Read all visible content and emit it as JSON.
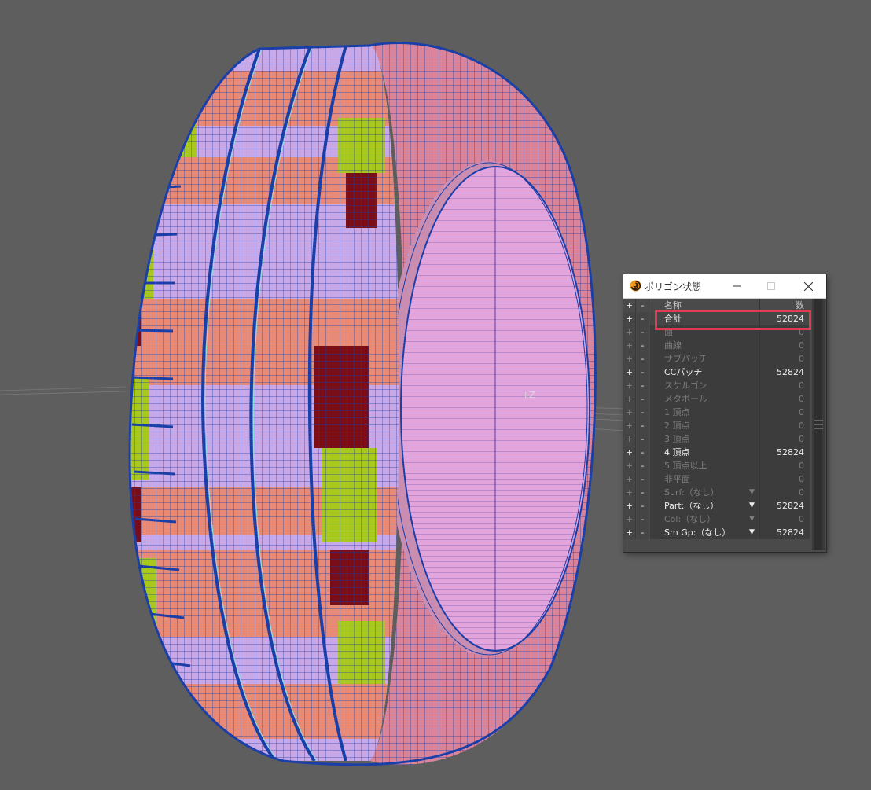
{
  "viewport": {
    "axis_label": "+Z"
  },
  "panel": {
    "title": "ポリゴン状態",
    "header": {
      "plus": "+",
      "minus": "-",
      "name": "名称",
      "count": "数"
    },
    "rows": [
      {
        "plus": "+",
        "minus": "-",
        "name": "合計",
        "count": "52824",
        "state": "active"
      },
      {
        "plus": "+",
        "minus": "-",
        "name": "面",
        "count": "0",
        "state": "dim"
      },
      {
        "plus": "+",
        "minus": "-",
        "name": "曲線",
        "count": "0",
        "state": "dim"
      },
      {
        "plus": "+",
        "minus": "-",
        "name": "サブパッチ",
        "count": "0",
        "state": "dim"
      },
      {
        "plus": "+",
        "minus": "-",
        "name": "CCパッチ",
        "count": "52824",
        "state": "active"
      },
      {
        "plus": "+",
        "minus": "-",
        "name": "スケルゴン",
        "count": "0",
        "state": "dim"
      },
      {
        "plus": "+",
        "minus": "-",
        "name": "メタボール",
        "count": "0",
        "state": "dim"
      },
      {
        "plus": "+",
        "minus": "-",
        "name": "1 頂点",
        "count": "0",
        "state": "dim"
      },
      {
        "plus": "+",
        "minus": "-",
        "name": "2 頂点",
        "count": "0",
        "state": "dim"
      },
      {
        "plus": "+",
        "minus": "-",
        "name": "3 頂点",
        "count": "0",
        "state": "dim"
      },
      {
        "plus": "+",
        "minus": "-",
        "name": "4 頂点",
        "count": "52824",
        "state": "active"
      },
      {
        "plus": "+",
        "minus": "-",
        "name": "5 頂点以上",
        "count": "0",
        "state": "dim"
      },
      {
        "plus": "+",
        "minus": "-",
        "name": "非平面",
        "count": "0",
        "state": "dim"
      },
      {
        "plus": "+",
        "minus": "-",
        "name": "Surf:（なし）",
        "count": "0",
        "state": "dim",
        "dropdown": true
      },
      {
        "plus": "+",
        "minus": "-",
        "name": "Part:（なし）",
        "count": "52824",
        "state": "active",
        "dropdown": true
      },
      {
        "plus": "+",
        "minus": "-",
        "name": "Col:（なし）",
        "count": "0",
        "state": "dim",
        "dropdown": true
      },
      {
        "plus": "+",
        "minus": "-",
        "name": "Sm Gp:（なし）",
        "count": "52824",
        "state": "active",
        "dropdown": true
      }
    ]
  },
  "colors": {
    "viewport_bg": "#5e5e5e",
    "wire": "#1a3fa8",
    "tread_violet": "#c9a8e8",
    "tread_salmon": "#e88a78",
    "tread_lime": "#a9c81e",
    "tread_maroon": "#7a0e18",
    "inner_pink": "#e3a4dc",
    "highlight": "#e03c54"
  },
  "icons": {
    "app": "lightwave-logo-icon",
    "minimize": "minimize-icon",
    "maximize": "maximize-icon",
    "close": "close-icon",
    "dropdown": "chevron-down-icon"
  }
}
